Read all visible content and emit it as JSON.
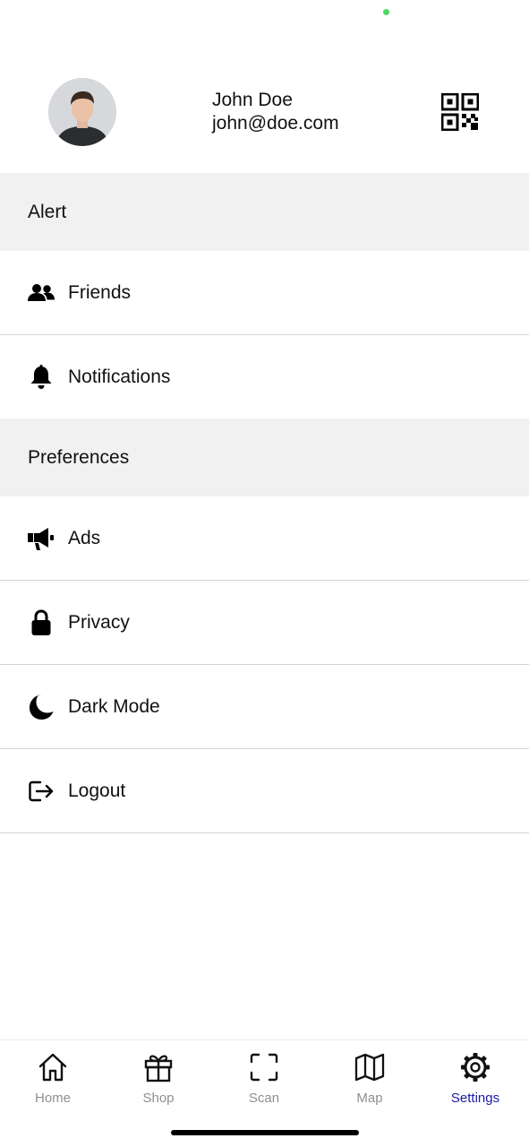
{
  "profile": {
    "name": "John Doe",
    "email": "john@doe.com"
  },
  "sections": {
    "alert": "Alert",
    "preferences": "Preferences"
  },
  "rows": {
    "friends": "Friends",
    "notifications": "Notifications",
    "ads": "Ads",
    "privacy": "Privacy",
    "dark_mode": "Dark Mode",
    "logout": "Logout"
  },
  "icons": {
    "friends": "people-icon",
    "notifications": "bell-icon",
    "ads": "megaphone-icon",
    "privacy": "lock-icon",
    "dark_mode": "moon-icon",
    "logout": "logout-icon",
    "qr": "qr-code-icon"
  },
  "tabbar": {
    "home": "Home",
    "shop": "Shop",
    "scan": "Scan",
    "map": "Map",
    "settings": "Settings",
    "active": "Settings"
  },
  "colors": {
    "active_tab": "#1a1aa8",
    "inactive_tab": "#8e8e93",
    "section_bg": "#f1f1f1",
    "status_dot": "#4cd964"
  }
}
